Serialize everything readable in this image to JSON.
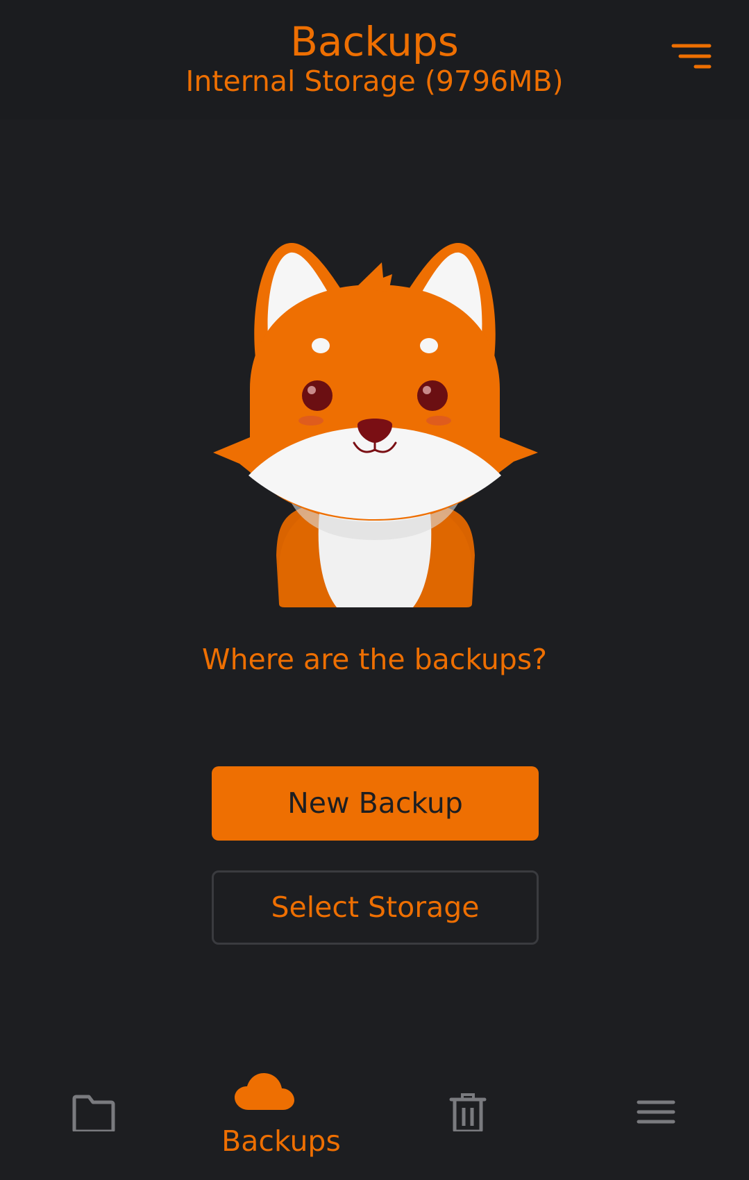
{
  "header": {
    "title": "Backups",
    "subtitle": "Internal Storage (9796MB)",
    "sort_icon": "sort-lines-icon"
  },
  "empty_state": {
    "illustration": "fox-mascot",
    "message": "Where are the backups?"
  },
  "actions": {
    "new_backup_label": "New Backup",
    "select_storage_label": "Select Storage"
  },
  "bottom_nav": {
    "items": [
      {
        "icon": "folder-icon",
        "label": "",
        "active": false
      },
      {
        "icon": "cloud-icon",
        "label": "Backups",
        "active": true
      },
      {
        "icon": "trash-icon",
        "label": "",
        "active": false
      },
      {
        "icon": "menu-icon",
        "label": "",
        "active": false
      }
    ]
  },
  "colors": {
    "accent": "#ee6f02",
    "background": "#1d1e21",
    "header_background": "#1b1c1f",
    "inactive_icon": "#7a7b7f",
    "outline": "#3a3b3f"
  }
}
